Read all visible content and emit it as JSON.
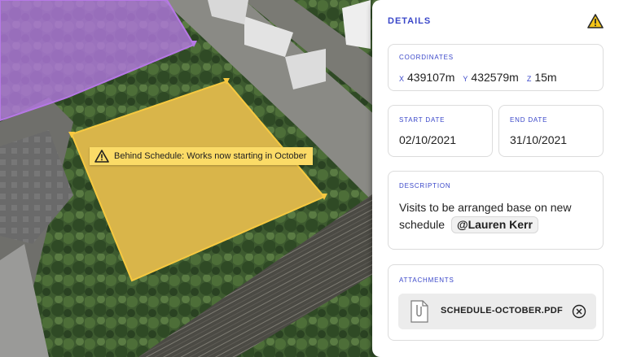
{
  "map": {
    "tooltip_text": "Behind Schedule: Works now starting in October",
    "zone_colors": {
      "delayed": "#f7c940",
      "other": "#b678e6"
    }
  },
  "panel": {
    "title": "DETAILS",
    "coordinates": {
      "label": "COORDINATES",
      "x_axis": "X",
      "x_value": "439107m",
      "y_axis": "Y",
      "y_value": "432579m",
      "z_axis": "Z",
      "z_value": "15m"
    },
    "start_date": {
      "label": "START DATE",
      "value": "02/10/2021"
    },
    "end_date": {
      "label": "END DATE",
      "value": "31/10/2021"
    },
    "description": {
      "label": "DESCRIPTION",
      "text": "Visits to be arranged base on new schedule",
      "mention": "@Lauren Kerr"
    },
    "attachments": {
      "label": "ATTACHMENTS",
      "file_name": "SCHEDULE-OCTOBER.PDF"
    }
  },
  "icons": {
    "warning": "warning-icon",
    "file": "paperclip-file-icon",
    "remove": "close-circle-icon"
  },
  "colors": {
    "accent": "#3a47c9",
    "warning": "#f5c518"
  }
}
